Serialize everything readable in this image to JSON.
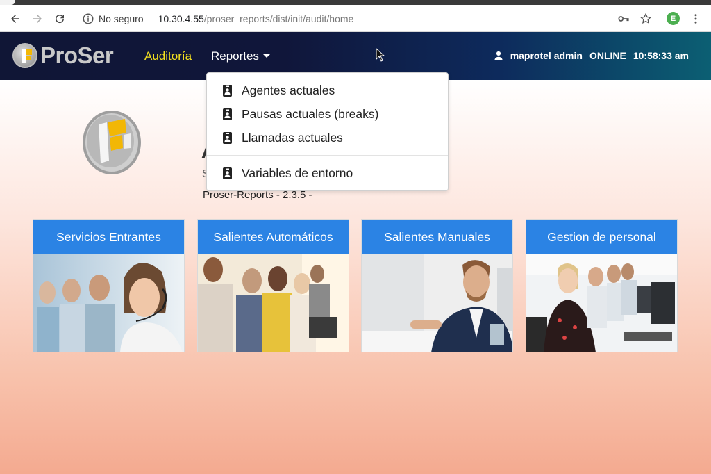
{
  "browser": {
    "security_label": "No seguro",
    "url_host": "10.30.4.55",
    "url_path": "/proser_reports/dist/init/audit/home",
    "profile_initial": "E"
  },
  "navbar": {
    "brand": "ProSer",
    "nav_items": [
      {
        "label": "Auditoría",
        "active": true
      },
      {
        "label": "Reportes",
        "active": false
      }
    ],
    "user": "maprotel admin",
    "status": "ONLINE",
    "time": "10:58:33 am"
  },
  "dropdown": {
    "items": [
      {
        "label": "Agentes actuales",
        "icon": "person-badge-icon"
      },
      {
        "label": "Pausas actuales (breaks)",
        "icon": "person-badge-icon"
      },
      {
        "label": "Llamadas actuales",
        "icon": "person-badge-icon"
      },
      {
        "label": "Variables de entorno",
        "icon": "person-badge-icon"
      }
    ]
  },
  "main": {
    "heading_partial": "A",
    "subtitle_partial": "S",
    "version": "Proser-Reports - 2.3.5 -",
    "cards": [
      {
        "title": "Servicios Entrantes"
      },
      {
        "title": "Salientes Automáticos"
      },
      {
        "title": "Salientes Manuales"
      },
      {
        "title": "Gestion de personal"
      }
    ]
  },
  "colors": {
    "navbar_start": "#101636",
    "navbar_end": "#0c5f73",
    "active_nav": "#f5e11f",
    "card_header": "#2b83e4"
  }
}
